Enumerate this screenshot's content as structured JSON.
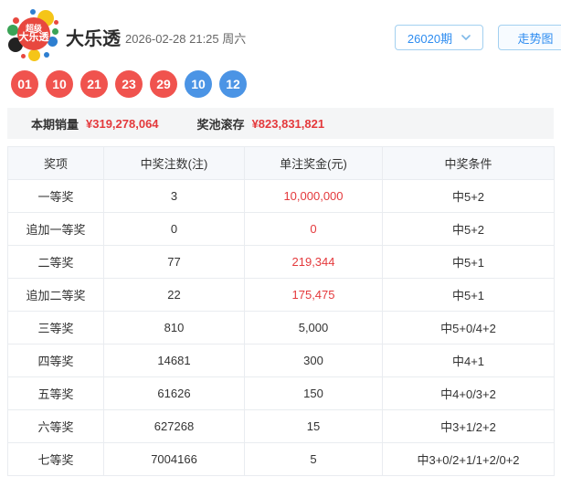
{
  "header": {
    "logo_text_top": "超级",
    "logo_text_bottom": "大乐透",
    "title": "大乐透",
    "datetime": "2026-02-28 21:25 周六",
    "issue_selector_label": "26020期",
    "trend_button_label": "走势图"
  },
  "balls": {
    "front": [
      "01",
      "10",
      "21",
      "23",
      "29"
    ],
    "back": [
      "10",
      "12"
    ]
  },
  "summary": {
    "sales_label": "本期销量",
    "sales_value": "¥319,278,064",
    "pool_label": "奖池滚存",
    "pool_value": "¥823,831,821"
  },
  "table": {
    "headers": [
      "奖项",
      "中奖注数(注)",
      "单注奖金(元)",
      "中奖条件"
    ],
    "rows": [
      {
        "name": "一等奖",
        "count": "3",
        "prize": "10,000,000",
        "prize_red": true,
        "condition": "中5+2"
      },
      {
        "name": "追加一等奖",
        "count": "0",
        "prize": "0",
        "prize_red": true,
        "condition": "中5+2"
      },
      {
        "name": "二等奖",
        "count": "77",
        "prize": "219,344",
        "prize_red": true,
        "condition": "中5+1"
      },
      {
        "name": "追加二等奖",
        "count": "22",
        "prize": "175,475",
        "prize_red": true,
        "condition": "中5+1"
      },
      {
        "name": "三等奖",
        "count": "810",
        "prize": "5,000",
        "prize_red": false,
        "condition": "中5+0/4+2"
      },
      {
        "name": "四等奖",
        "count": "14681",
        "prize": "300",
        "prize_red": false,
        "condition": "中4+1"
      },
      {
        "name": "五等奖",
        "count": "61626",
        "prize": "150",
        "prize_red": false,
        "condition": "中4+0/3+2"
      },
      {
        "name": "六等奖",
        "count": "627268",
        "prize": "15",
        "prize_red": false,
        "condition": "中3+1/2+2"
      },
      {
        "name": "七等奖",
        "count": "7004166",
        "prize": "5",
        "prize_red": false,
        "condition": "中3+0/2+1/1+2/0+2"
      }
    ]
  },
  "colors": {
    "front_ball": "#f0534e",
    "back_ball": "#4b94e5",
    "highlight_red": "#e4393c",
    "accent_blue": "#2d8cf0",
    "logo_red": "#e8483f"
  }
}
